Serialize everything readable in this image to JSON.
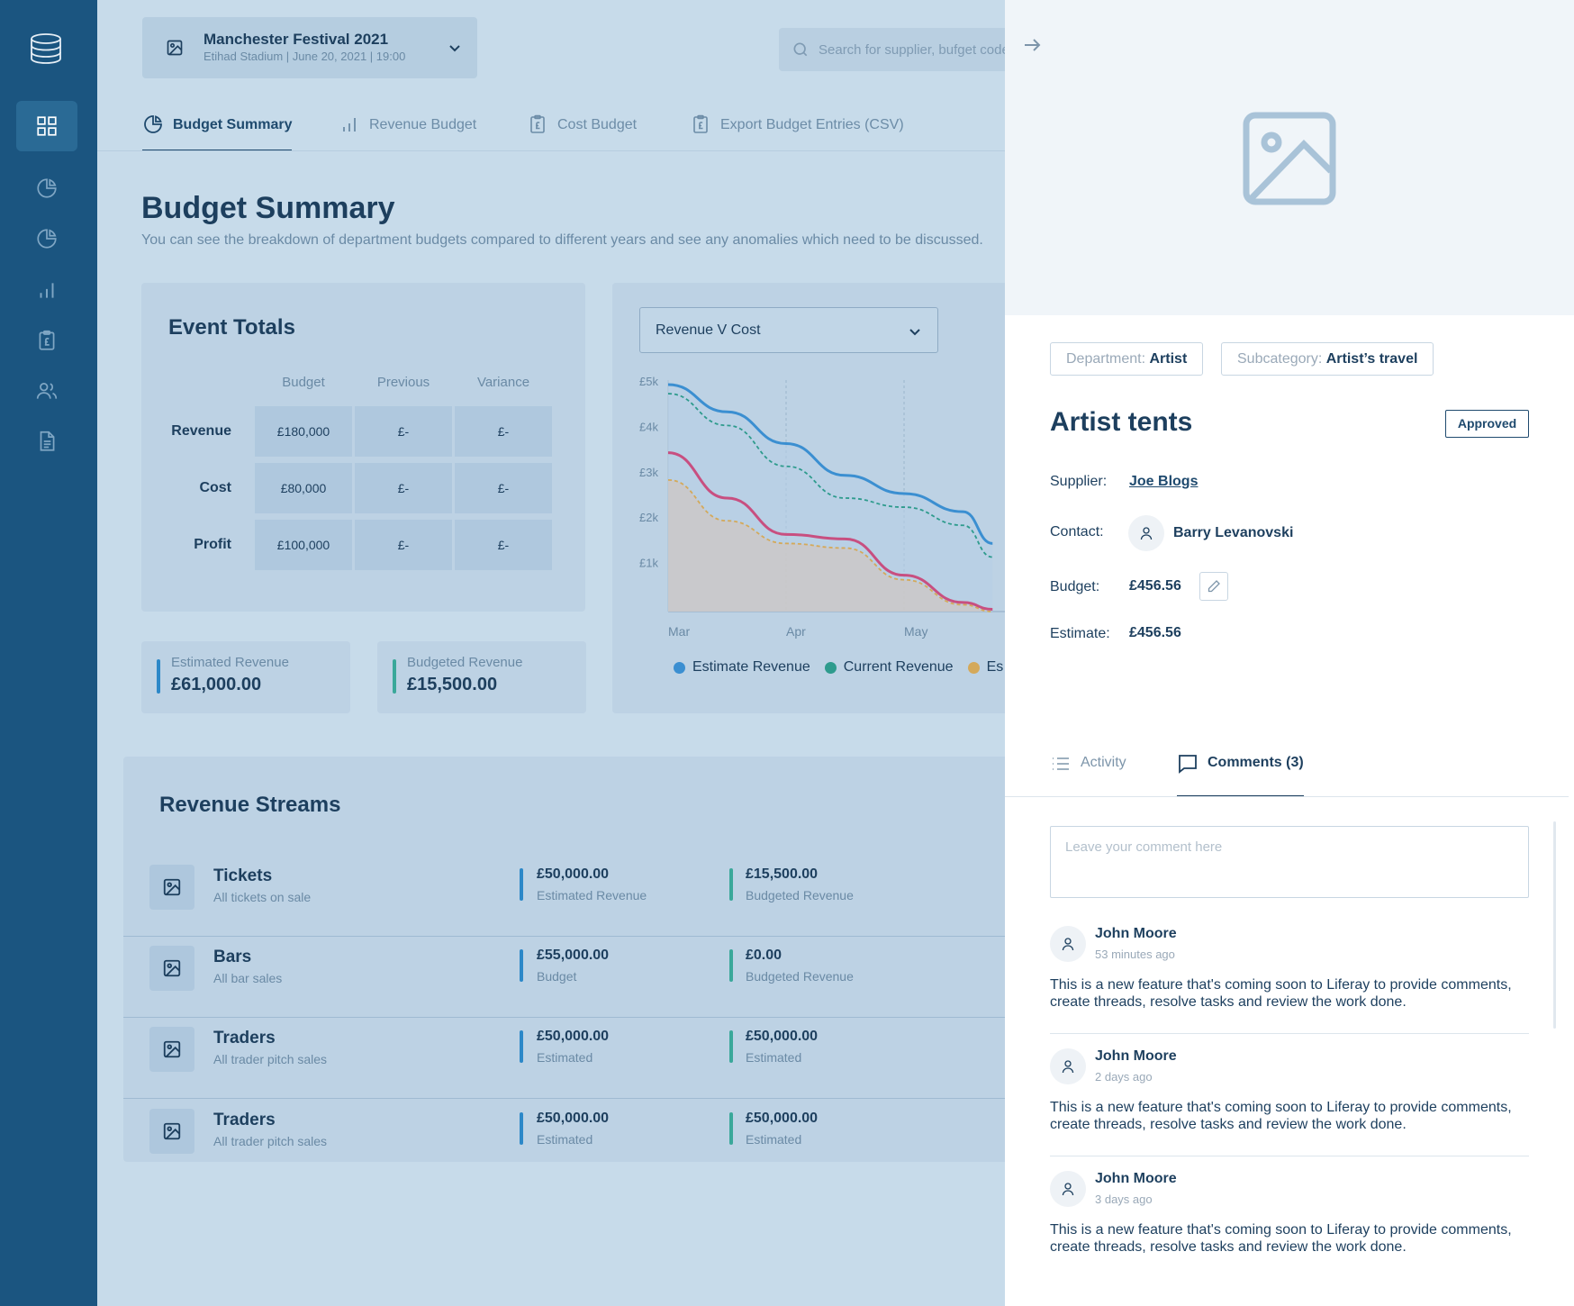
{
  "event": {
    "title": "Manchester Festival 2021",
    "subtitle": "Etihad Stadium | June 20, 2021 | 19:00"
  },
  "search": {
    "placeholder": "Search for supplier, bufget code..."
  },
  "tabs": [
    {
      "label": "Budget Summary",
      "icon": "pie-chart-icon",
      "active": true
    },
    {
      "label": "Revenue Budget",
      "icon": "bar-chart-icon"
    },
    {
      "label": "Cost Budget",
      "icon": "clipboard-pound-icon"
    },
    {
      "label": "Export Budget Entries (CSV)",
      "icon": "clipboard-pound-icon"
    }
  ],
  "page": {
    "title": "Budget Summary",
    "description": "You can see the breakdown of department budgets compared to different years and see any anomalies which need to be discussed."
  },
  "totals": {
    "title": "Event Totals",
    "columns": [
      "Budget",
      "Previous",
      "Variance"
    ],
    "rows": [
      {
        "label": "Revenue",
        "values": [
          "£180,000",
          "£-",
          "£-"
        ]
      },
      {
        "label": "Cost",
        "values": [
          "£80,000",
          "£-",
          "£-"
        ]
      },
      {
        "label": "Profit",
        "values": [
          "£100,000",
          "£-",
          "£-"
        ]
      }
    ]
  },
  "kpis": [
    {
      "label": "Estimated Revenue",
      "value": "£61,000.00"
    },
    {
      "label": "Budgeted Revenue",
      "value": "£15,500.00"
    }
  ],
  "chart": {
    "select": "Revenue V Cost"
  },
  "chart_data": {
    "type": "line",
    "x": [
      "Mar",
      "Apr",
      "May"
    ],
    "y_ticks": [
      "£5k",
      "£4k",
      "£3k",
      "£2k",
      "£1k"
    ],
    "ylim": [
      0,
      5000
    ],
    "grid": "vertical dashed",
    "legend_position": "bottom",
    "series": [
      {
        "name": "Estimate Revenue",
        "color": "#3b8fd1",
        "style": "solid",
        "points": [
          [
            0,
            5000
          ],
          [
            0.5,
            4400
          ],
          [
            1,
            3700
          ],
          [
            1.5,
            3000
          ],
          [
            2,
            2600
          ],
          [
            2.5,
            2200
          ],
          [
            2.75,
            1500
          ]
        ]
      },
      {
        "name": "Current Revenue",
        "color": "#2e9b8d",
        "style": "dashed",
        "points": [
          [
            0,
            4800
          ],
          [
            0.5,
            4100
          ],
          [
            1,
            3200
          ],
          [
            1.5,
            2500
          ],
          [
            2,
            2300
          ],
          [
            2.5,
            1900
          ],
          [
            2.75,
            1200
          ]
        ]
      },
      {
        "name": "Es",
        "color": "#d4a95a",
        "style": "dashed-area",
        "points": [
          [
            0,
            2900
          ],
          [
            0.5,
            2000
          ],
          [
            1,
            1500
          ],
          [
            1.5,
            1400
          ],
          [
            2,
            700
          ],
          [
            2.5,
            150
          ],
          [
            2.75,
            0
          ]
        ]
      },
      {
        "name": "",
        "color": "#c84f80",
        "style": "solid",
        "points": [
          [
            0,
            3500
          ],
          [
            0.5,
            2500
          ],
          [
            1,
            1700
          ],
          [
            1.5,
            1600
          ],
          [
            2,
            800
          ],
          [
            2.5,
            200
          ],
          [
            2.75,
            50
          ]
        ]
      }
    ]
  },
  "streams": {
    "title": "Revenue Streams",
    "rows": [
      {
        "name": "Tickets",
        "desc": "All tickets on sale",
        "m1_value": "£50,000.00",
        "m1_label": "Estimated Revenue",
        "m2_value": "£15,500.00",
        "m2_label": "Budgeted Revenue"
      },
      {
        "name": "Bars",
        "desc": "All bar sales",
        "m1_value": "£55,000.00",
        "m1_label": "Budget",
        "m2_value": "£0.00",
        "m2_label": "Budgeted Revenue"
      },
      {
        "name": "Traders",
        "desc": "All trader pitch sales",
        "m1_value": "£50,000.00",
        "m1_label": "Estimated",
        "m2_value": "£50,000.00",
        "m2_label": "Estimated"
      },
      {
        "name": "Traders",
        "desc": "All trader pitch sales",
        "m1_value": "£50,000.00",
        "m1_label": "Estimated",
        "m2_value": "£50,000.00",
        "m2_label": "Estimated"
      }
    ]
  },
  "panel": {
    "department_key": "Department:",
    "department_value": "Artist",
    "subcategory_key": "Subcategory:",
    "subcategory_value": "Artist’s travel",
    "title": "Artist tents",
    "status": "Approved",
    "supplier_key": "Supplier:",
    "supplier_value": "Joe Blogs",
    "contact_key": "Contact:",
    "contact_value": "Barry Levanovski",
    "budget_key": "Budget:",
    "budget_value": "£456.56",
    "estimate_key": "Estimate:",
    "estimate_value": "£456.56",
    "tabs": [
      {
        "label": "Activity",
        "icon": "list-icon"
      },
      {
        "label": "Comments (3)",
        "icon": "comment-icon",
        "active": true
      }
    ],
    "comment_placeholder": "Leave your comment here",
    "comments": [
      {
        "author": "John Moore",
        "time": "53 minutes ago",
        "text": "This is a new feature that's coming soon to Liferay to provide comments, create threads, resolve tasks and review the work done."
      },
      {
        "author": "John Moore",
        "time": "2 days ago",
        "text": "This is a new feature that's coming soon to Liferay to provide comments, create threads, resolve tasks and review the work done."
      },
      {
        "author": "John Moore",
        "time": "3 days ago",
        "text": "This is a new feature that's coming soon to Liferay to provide comments, create threads, resolve tasks and review the work done."
      }
    ]
  },
  "colors": {
    "sidebar": "#1b5580",
    "accent_blue": "#2c88c8",
    "accent_teal": "#3aa89a",
    "ink": "#1d3f5e"
  }
}
